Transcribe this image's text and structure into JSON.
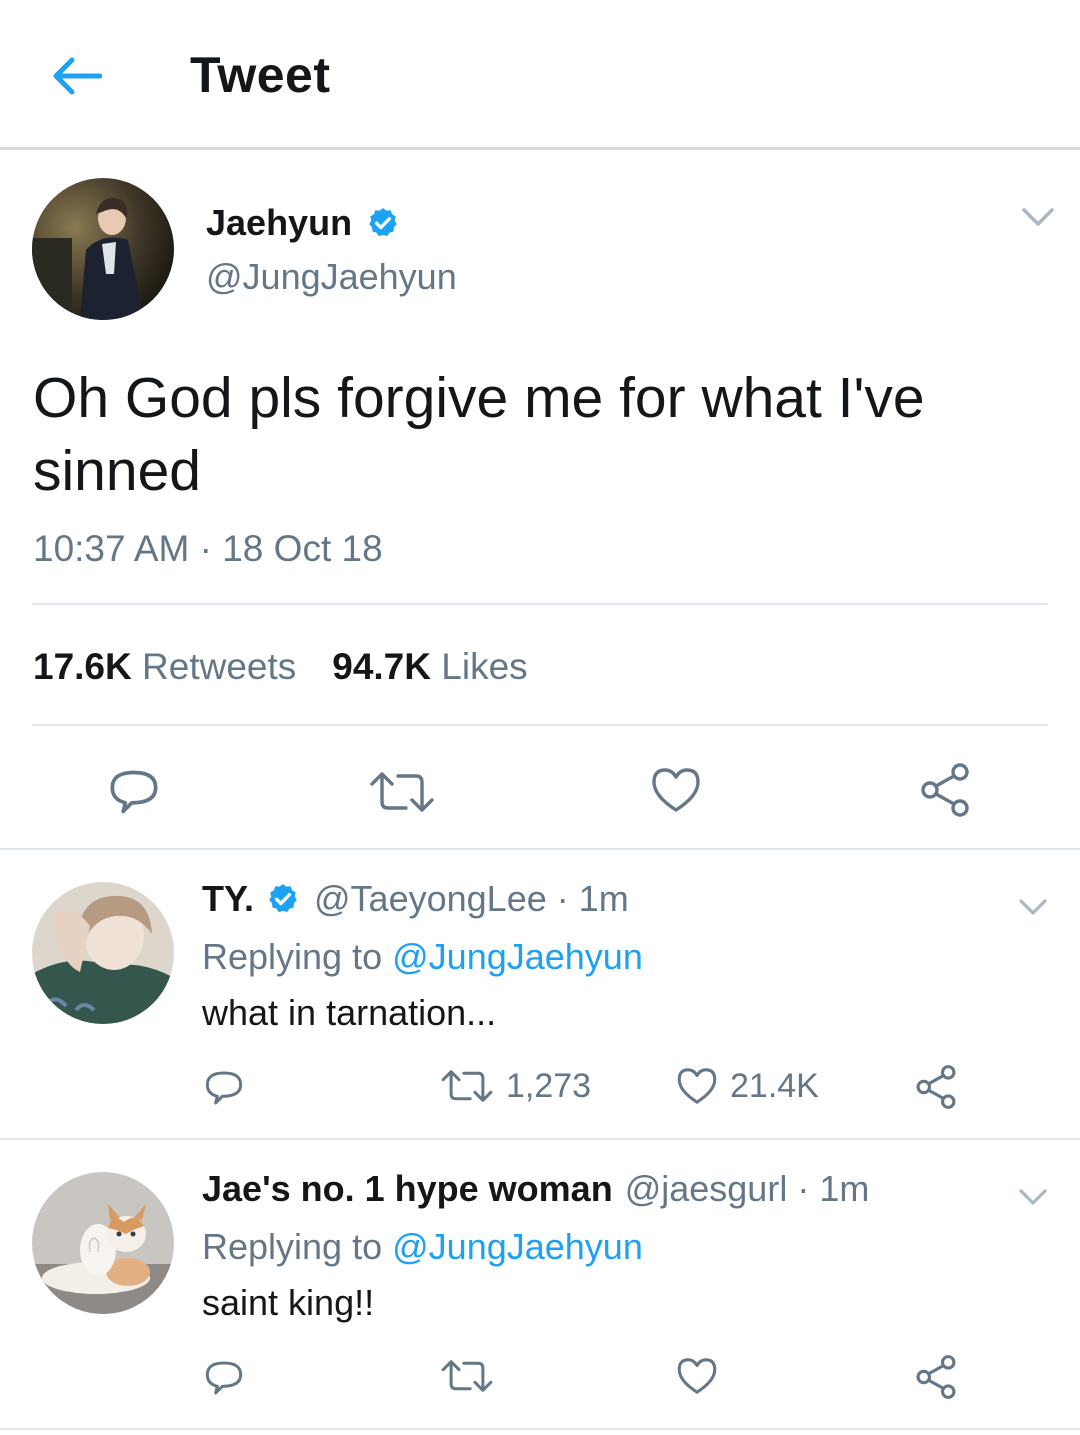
{
  "header": {
    "title": "Tweet"
  },
  "main_tweet": {
    "author_name": "Jaehyun",
    "author_handle": "@JungJaehyun",
    "text": "Oh God pls forgive me for what I've sinned",
    "time": "10:37 AM",
    "date": "18 Oct 18",
    "retweets_count": "17.6K",
    "retweets_label": "Retweets",
    "likes_count": "94.7K",
    "likes_label": "Likes"
  },
  "replies": [
    {
      "name": "TY.",
      "verified": true,
      "handle": "@TaeyongLee",
      "time": "1m",
      "replying_label": "Replying to",
      "replying_to": "@JungJaehyun",
      "text": "what in tarnation...",
      "retweets": "1,273",
      "likes": "21.4K"
    },
    {
      "name": "Jae's no. 1 hype woman",
      "verified": false,
      "handle": "@jaesgurl",
      "time": "1m",
      "replying_label": "Replying to",
      "replying_to": "@JungJaehyun",
      "text": "saint king!!"
    }
  ],
  "separator": "·",
  "colors": {
    "accent": "#1da1f2",
    "text": "#14171a",
    "secondary": "#657786",
    "border": "#e1e8ed"
  },
  "icons": [
    "back-arrow-icon",
    "verified-badge-icon",
    "chevron-down-icon",
    "reply-icon",
    "retweet-icon",
    "like-icon",
    "share-icon"
  ]
}
